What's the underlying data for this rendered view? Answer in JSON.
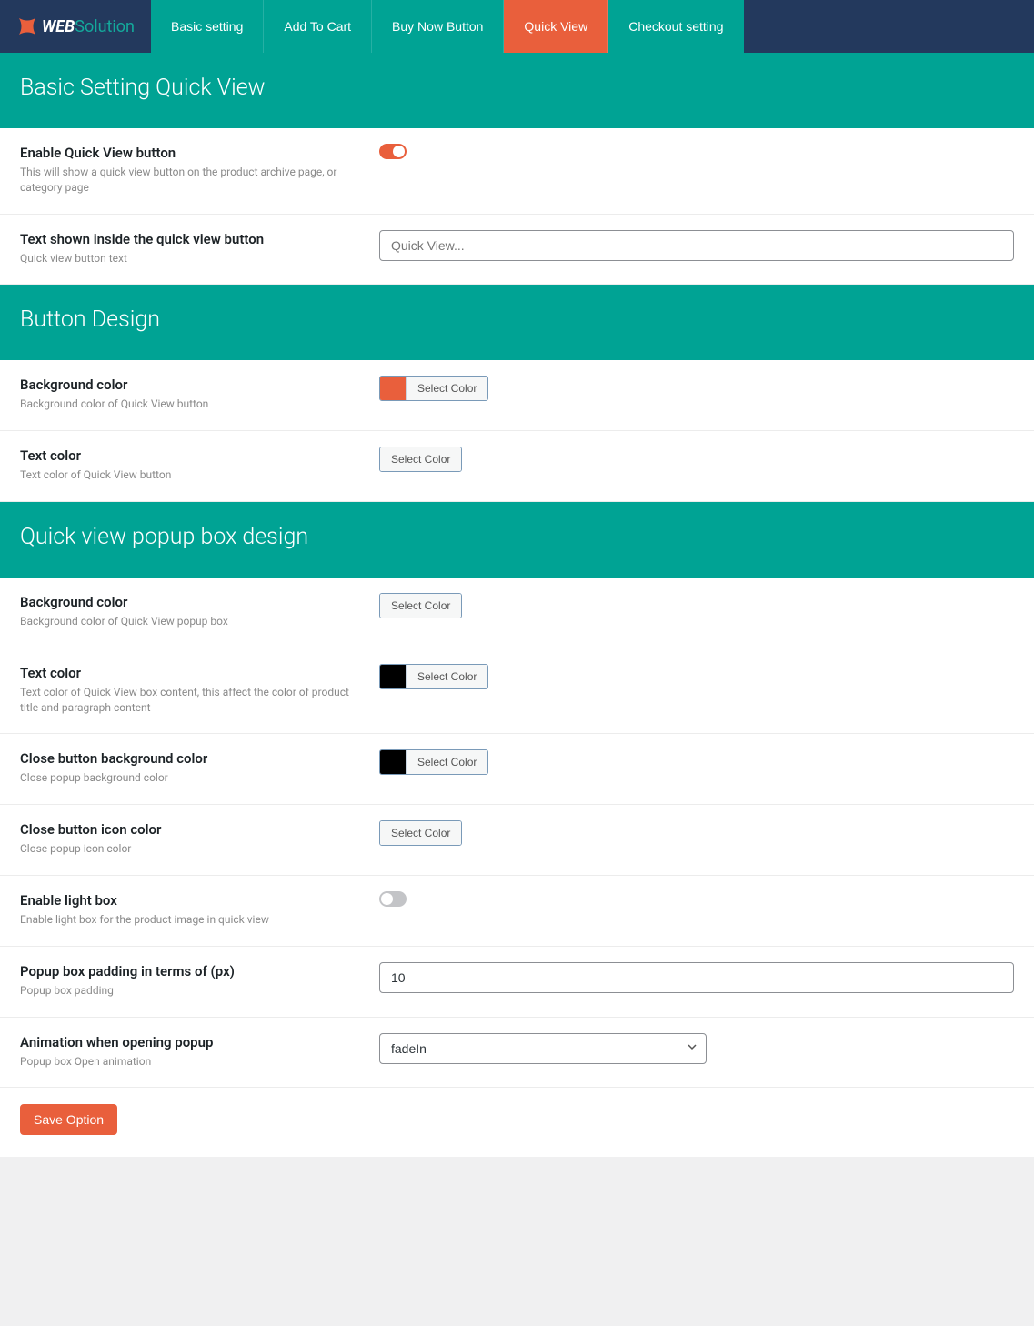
{
  "logo": {
    "web": "WEB",
    "solution": "Solution"
  },
  "tabs": [
    {
      "label": "Basic setting"
    },
    {
      "label": "Add To Cart"
    },
    {
      "label": "Buy Now Button"
    },
    {
      "label": "Quick View"
    },
    {
      "label": "Checkout setting"
    }
  ],
  "sections": {
    "basic": {
      "title": "Basic Setting Quick View",
      "enable": {
        "title": "Enable Quick View button",
        "desc": "This will show a quick view button on the product archive page, or category page"
      },
      "text_inside": {
        "title": "Text shown inside the quick view button",
        "desc": "Quick view button text",
        "placeholder": "Quick View..."
      }
    },
    "design": {
      "title": "Button Design",
      "bg": {
        "title": "Background color",
        "desc": "Background color of Quick View button",
        "swatch": "#e95f3c",
        "btn": "Select Color"
      },
      "text": {
        "title": "Text color",
        "desc": "Text color of Quick View button",
        "swatch": "",
        "btn": "Select Color"
      }
    },
    "popup": {
      "title": "Quick view popup box design",
      "bg": {
        "title": "Background color",
        "desc": "Background color of Quick View popup box",
        "swatch": "",
        "btn": "Select Color"
      },
      "text": {
        "title": "Text color",
        "desc": "Text color of Quick View box content, this affect the color of product title and paragraph content",
        "swatch": "#000000",
        "btn": "Select Color"
      },
      "close_bg": {
        "title": "Close button background color",
        "desc": "Close popup background color",
        "swatch": "#000000",
        "btn": "Select Color"
      },
      "close_icon": {
        "title": "Close button icon color",
        "desc": "Close popup icon color",
        "swatch": "",
        "btn": "Select Color"
      },
      "lightbox": {
        "title": "Enable light box",
        "desc": "Enable light box for the product image in quick view"
      },
      "padding": {
        "title": "Popup box padding in terms of (px)",
        "desc": "Popup box padding",
        "value": "10"
      },
      "animation": {
        "title": "Animation when opening popup",
        "desc": "Popup box Open animation",
        "value": "fadeIn"
      }
    }
  },
  "save": "Save Option"
}
